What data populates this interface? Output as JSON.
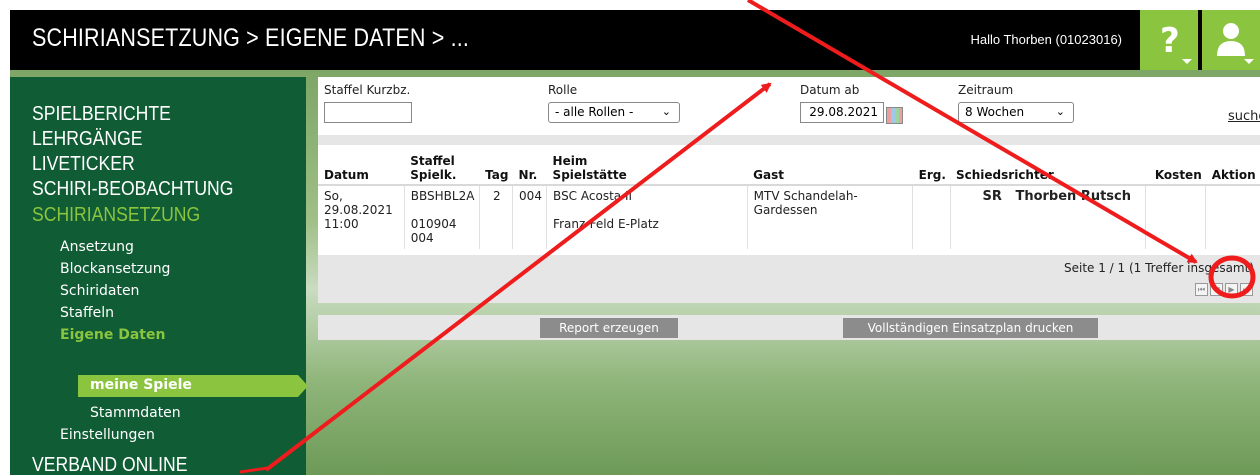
{
  "header": {
    "title": "SCHIRIANSETZUNG > EIGENE DATEN > ...",
    "greeting": "Hallo Thorben (01023016)",
    "help_icon": "question-mark-icon",
    "user_icon": "user-icon"
  },
  "sidebar": {
    "main_items": [
      "SPIELBERICHTE",
      "LEHRGÄNGE",
      "LIVETICKER",
      "SCHIRI-BEOBACHTUNG",
      "SCHIRIANSETZUNG"
    ],
    "sub_items": [
      "Ansetzung",
      "Blockansetzung",
      "Schiridaten",
      "Staffeln",
      "Eigene Daten"
    ],
    "active_sub": "meine Spiele",
    "stammdaten": "Stammdaten",
    "einstellungen": "Einstellungen",
    "verband": "VERBAND ONLINE"
  },
  "filters": {
    "staffel_label": "Staffel Kurzbz.",
    "staffel_value": "",
    "rolle_label": "Rolle",
    "rolle_value": "- alle Rollen -",
    "datum_label": "Datum ab",
    "datum_value": "29.08.2021",
    "zeitraum_label": "Zeitraum",
    "zeitraum_value": "8 Wochen",
    "search_link": "suche"
  },
  "table": {
    "headers": {
      "datum": "Datum",
      "staffel1": "Staffel",
      "staffel2": "Spielk.",
      "tag": "Tag",
      "nr": "Nr.",
      "heim1": "Heim",
      "heim2": "Spielstätte",
      "gast": "Gast",
      "erg": "Erg.",
      "schiri": "Schiedsrichter",
      "kosten": "Kosten",
      "aktion": "Aktion"
    },
    "row": {
      "datum_day": "So,",
      "datum_date": "29.08.2021",
      "datum_time": "11:00",
      "staffel": "BBSHBL2A",
      "spielk1": "010904",
      "spielk2": "004",
      "tag": "2",
      "nr": "004",
      "heim": "BSC Acosta II",
      "spielstaette": "Franz-Feld E-Platz",
      "gast1": "MTV Schandelah-",
      "gast2": "Gardessen",
      "erg": "",
      "rolle": "SR",
      "schiri": "Thorben Rutsch",
      "kosten": "",
      "aktion_icon": "euro-document-icon"
    }
  },
  "pager": {
    "info": "Seite 1 / 1 (1 Treffer insgesamt)"
  },
  "actions": {
    "report": "Report erzeugen",
    "print": "Vollständigen Einsatzplan drucken"
  },
  "colors": {
    "brand_green": "#8bc53f",
    "sidebar_green": "#0f5c35",
    "annotation_red": "#ee1c1c"
  }
}
